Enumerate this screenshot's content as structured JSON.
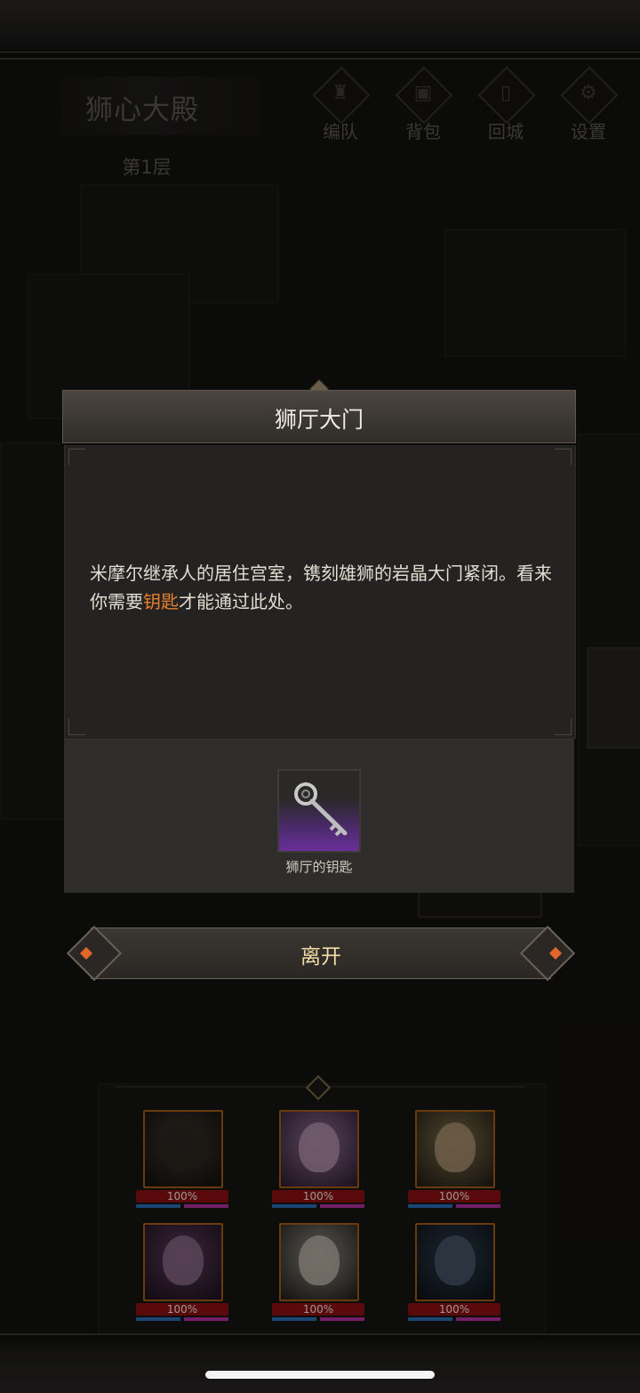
{
  "header": {
    "location_name": "狮心大殿",
    "floor": "第1层",
    "menu": [
      {
        "label": "编队",
        "icon": "helmet-icon"
      },
      {
        "label": "背包",
        "icon": "backpack-icon"
      },
      {
        "label": "回城",
        "icon": "door-icon"
      },
      {
        "label": "设置",
        "icon": "gear-icon"
      }
    ]
  },
  "dialog": {
    "title": "狮厅大门",
    "text_before": "米摩尔继承人的居住宫室，镌刻雄狮的岩晶大门紧闭。看来你需要",
    "text_highlight": "钥匙",
    "text_after": "才能通过此处。",
    "highlight_color": "#e8802e",
    "reward_item": {
      "name": "狮厅的钥匙",
      "icon": "key-icon",
      "rarity_color": "#6a2f9a"
    },
    "leave_button": "离开"
  },
  "party": [
    {
      "hp": "100%",
      "hp_level": 1.0
    },
    {
      "hp": "100%",
      "hp_level": 1.0
    },
    {
      "hp": "100%",
      "hp_level": 1.0
    },
    {
      "hp": "100%",
      "hp_level": 1.0
    },
    {
      "hp": "100%",
      "hp_level": 1.0
    },
    {
      "hp": "100%",
      "hp_level": 1.0
    }
  ]
}
